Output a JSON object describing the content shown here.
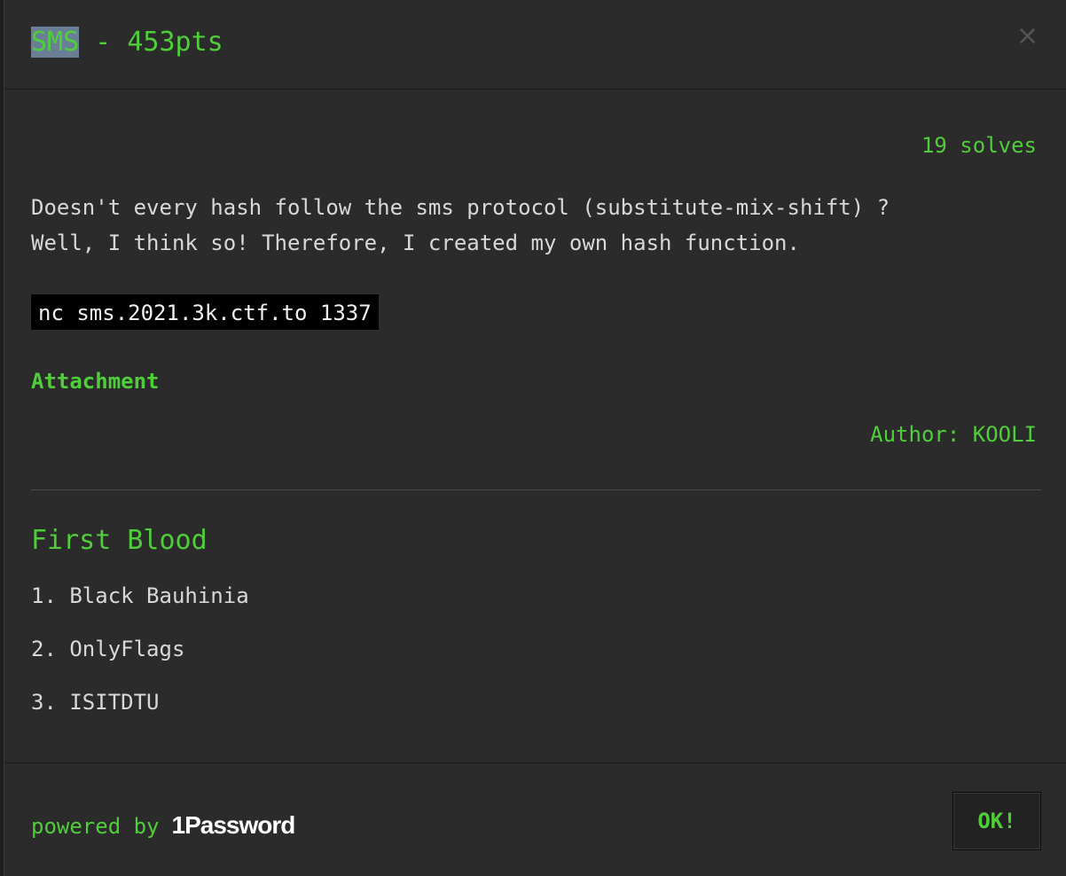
{
  "header": {
    "title_highlight": "SMS",
    "title_rest": " - 453pts",
    "close_glyph": "×"
  },
  "body": {
    "solves": "19 solves",
    "description": [
      "Doesn't every hash follow the sms protocol (substitute-mix-shift) ?",
      "Well, I think so! Therefore, I created my own hash function."
    ],
    "command": "nc sms.2021.3k.ctf.to 1337",
    "attachment_label": "Attachment",
    "author": "Author: KOOLI"
  },
  "first_blood": {
    "title": "First Blood",
    "entries": [
      "1. Black Bauhinia",
      "2. OnlyFlags",
      "3. ISITDTU"
    ]
  },
  "footer": {
    "powered_by": "powered by",
    "logo_text": "1Password",
    "ok_label": "OK!"
  },
  "colors": {
    "accent": "#4fce3a",
    "background": "#2b2b2b",
    "text": "#d8d8d8",
    "highlight": "#6a7f96"
  }
}
